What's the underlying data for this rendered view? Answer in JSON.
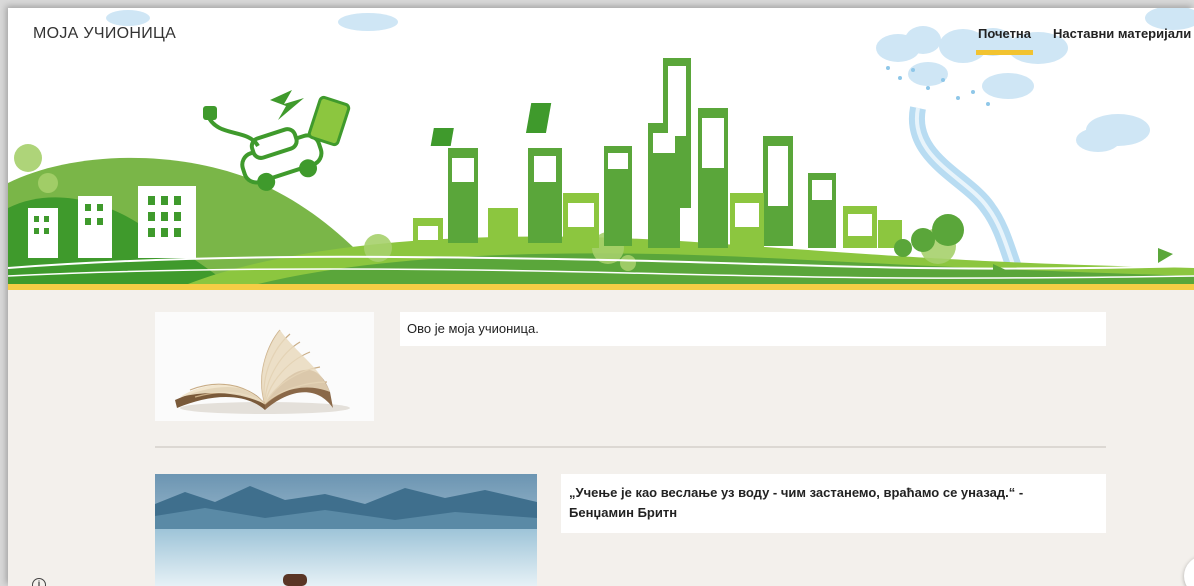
{
  "site": {
    "title": "МОЈА УЧИОНИЦА"
  },
  "nav": {
    "items": [
      {
        "label": "Почетна",
        "active": true
      },
      {
        "label": "Наставни материјали",
        "has_dropdown": true
      }
    ]
  },
  "content": {
    "intro_text": "Ово је моја учионица.",
    "quote_line1": "„Учење је као веслање уз воду - чим застанемо, враћамо се уназад.“ -",
    "quote_line2": "Бенџамин Бритн"
  },
  "colors": {
    "accent": "#f6cd45",
    "green_dark": "#3f9a2c",
    "green_light": "#8cc63f",
    "sky": "#d6eaf6"
  },
  "icons": {
    "info": "info-icon",
    "dropdown": "chevron-down-icon"
  }
}
